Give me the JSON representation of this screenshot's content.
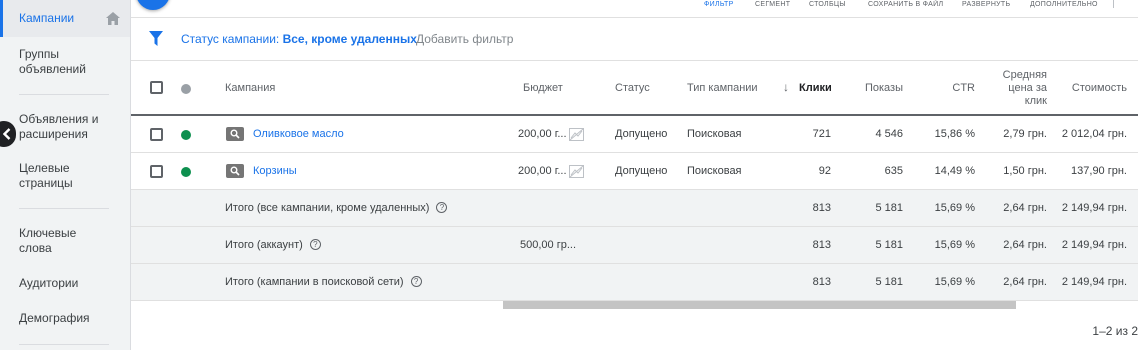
{
  "sidebar": {
    "active": "Кампании",
    "items": [
      "Группы объявлений",
      "Объявления и расширения",
      "Целевые страницы",
      "Ключевые слова",
      "Аудитории",
      "Демография"
    ]
  },
  "toolbar": {
    "items": [
      "ФИЛЬТР",
      "СЕГМЕНТ",
      "СТОЛБЦЫ",
      "СОХРАНИТЬ В ФАЙЛ",
      "РАЗВЕРНУТЬ",
      "ДОПОЛНИТЕЛЬНО"
    ]
  },
  "filter": {
    "label": "Статус кампании:",
    "value": "Все, кроме удаленных",
    "add": "Добавить фильтр"
  },
  "columns": {
    "campaign": "Кампания",
    "budget": "Бюджет",
    "status": "Статус",
    "type": "Тип кампании",
    "clicks": "Клики",
    "impressions": "Показы",
    "ctr": "CTR",
    "avg_cpc_1": "Средняя",
    "avg_cpc_2": "цена за",
    "avg_cpc_3": "клик",
    "cost": "Стоимость"
  },
  "rows": [
    {
      "campaign": "Оливковое масло",
      "budget": "200,00 г...",
      "status": "Допущено",
      "type": "Поисковая",
      "clicks": "721",
      "impressions": "4 546",
      "ctr": "15,86 %",
      "avg_cpc": "2,79 грн.",
      "cost": "2 012,04 грн."
    },
    {
      "campaign": "Корзины",
      "budget": "200,00 г...",
      "status": "Допущено",
      "type": "Поисковая",
      "clicks": "92",
      "impressions": "635",
      "ctr": "14,49 %",
      "avg_cpc": "1,50 грн.",
      "cost": "137,90 грн."
    }
  ],
  "totals": [
    {
      "label": "Итого (все кампании, кроме удаленных)",
      "budget": "",
      "clicks": "813",
      "impressions": "5 181",
      "ctr": "15,69 %",
      "avg_cpc": "2,64 грн.",
      "cost": "2 149,94 грн."
    },
    {
      "label": "Итого (аккаунт)",
      "budget": "500,00 гр...",
      "clicks": "813",
      "impressions": "5 181",
      "ctr": "15,69 %",
      "avg_cpc": "2,64 грн.",
      "cost": "2 149,94 грн."
    },
    {
      "label": "Итого (кампании в поисковой сети)",
      "budget": "",
      "clicks": "813",
      "impressions": "5 181",
      "ctr": "15,69 %",
      "avg_cpc": "2,64 грн.",
      "cost": "2 149,94 грн."
    }
  ],
  "pagination": "1–2 из 2",
  "colors": {
    "accent": "#1a73e8",
    "enabled": "#0d904f"
  }
}
